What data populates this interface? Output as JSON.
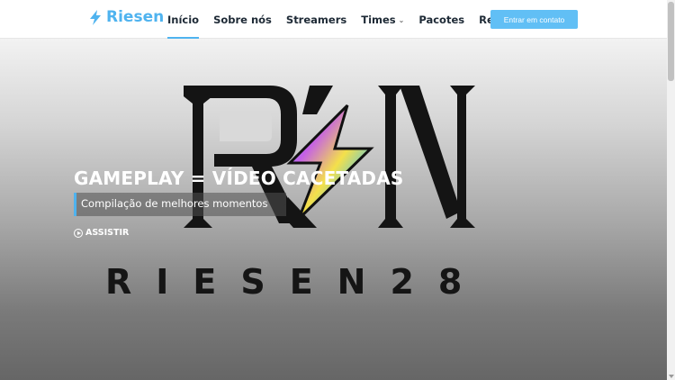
{
  "brand": {
    "name": "Riesen",
    "icon": "lightning-icon",
    "color": "#4fb3ef"
  },
  "nav": {
    "items": [
      {
        "label": "Início",
        "active": true,
        "dropdown": false
      },
      {
        "label": "Sobre nós",
        "active": false,
        "dropdown": false
      },
      {
        "label": "Streamers",
        "active": false,
        "dropdown": false
      },
      {
        "label": "Times",
        "active": false,
        "dropdown": true
      },
      {
        "label": "Pacotes",
        "active": false,
        "dropdown": false
      },
      {
        "label": "Redes",
        "active": false,
        "dropdown": true
      }
    ],
    "cta_label": "Entrar em contato"
  },
  "hero": {
    "title": "GAMEPLAY = VÍDEO CACETADAS",
    "subtitle": "Compilação de melhores momentos",
    "cta_label": "ASSISTIR",
    "cta_icon": "play-circle-icon",
    "logo_wordmark": "RIESEN28"
  },
  "colors": {
    "accent": "#4fb3ef",
    "cta_bg": "#61bff5",
    "nav_text": "#1e2a36"
  }
}
